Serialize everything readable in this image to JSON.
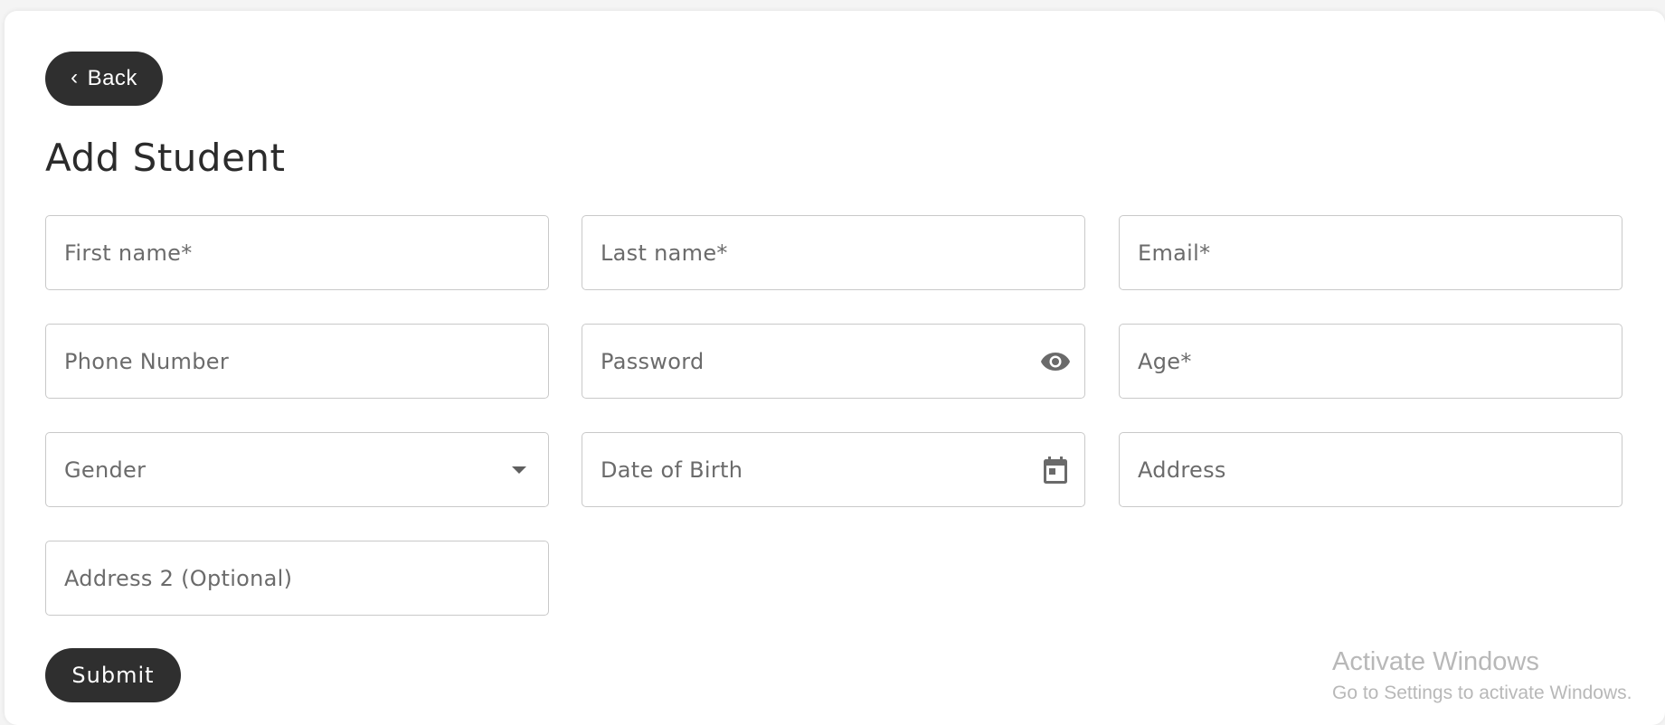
{
  "header": {
    "back_label": "Back",
    "page_title": "Add Student"
  },
  "form": {
    "first_name": {
      "value": "",
      "placeholder": "First name*"
    },
    "last_name": {
      "value": "",
      "placeholder": "Last name*"
    },
    "email": {
      "value": "",
      "placeholder": "Email*"
    },
    "phone": {
      "value": "",
      "placeholder": "Phone Number"
    },
    "password": {
      "value": "",
      "placeholder": "Password",
      "trailing_icon": "eye-icon"
    },
    "age": {
      "value": "",
      "placeholder": "Age*"
    },
    "gender": {
      "label": "Gender",
      "trailing_icon": "dropdown-arrow-icon"
    },
    "dob": {
      "value": "",
      "placeholder": "Date of Birth",
      "trailing_icon": "calendar-icon"
    },
    "address": {
      "value": "",
      "placeholder": "Address"
    },
    "address2": {
      "value": "",
      "placeholder": "Address 2 (Optional)"
    },
    "submit_label": "Submit"
  },
  "watermark": {
    "line1": "Activate Windows",
    "line2": "Go to Settings to activate Windows."
  },
  "colors": {
    "button_bg": "#2f2f2f",
    "border": "#c9c9c9",
    "placeholder": "#6b6b6b",
    "page_bg": "#f4f4f4"
  }
}
